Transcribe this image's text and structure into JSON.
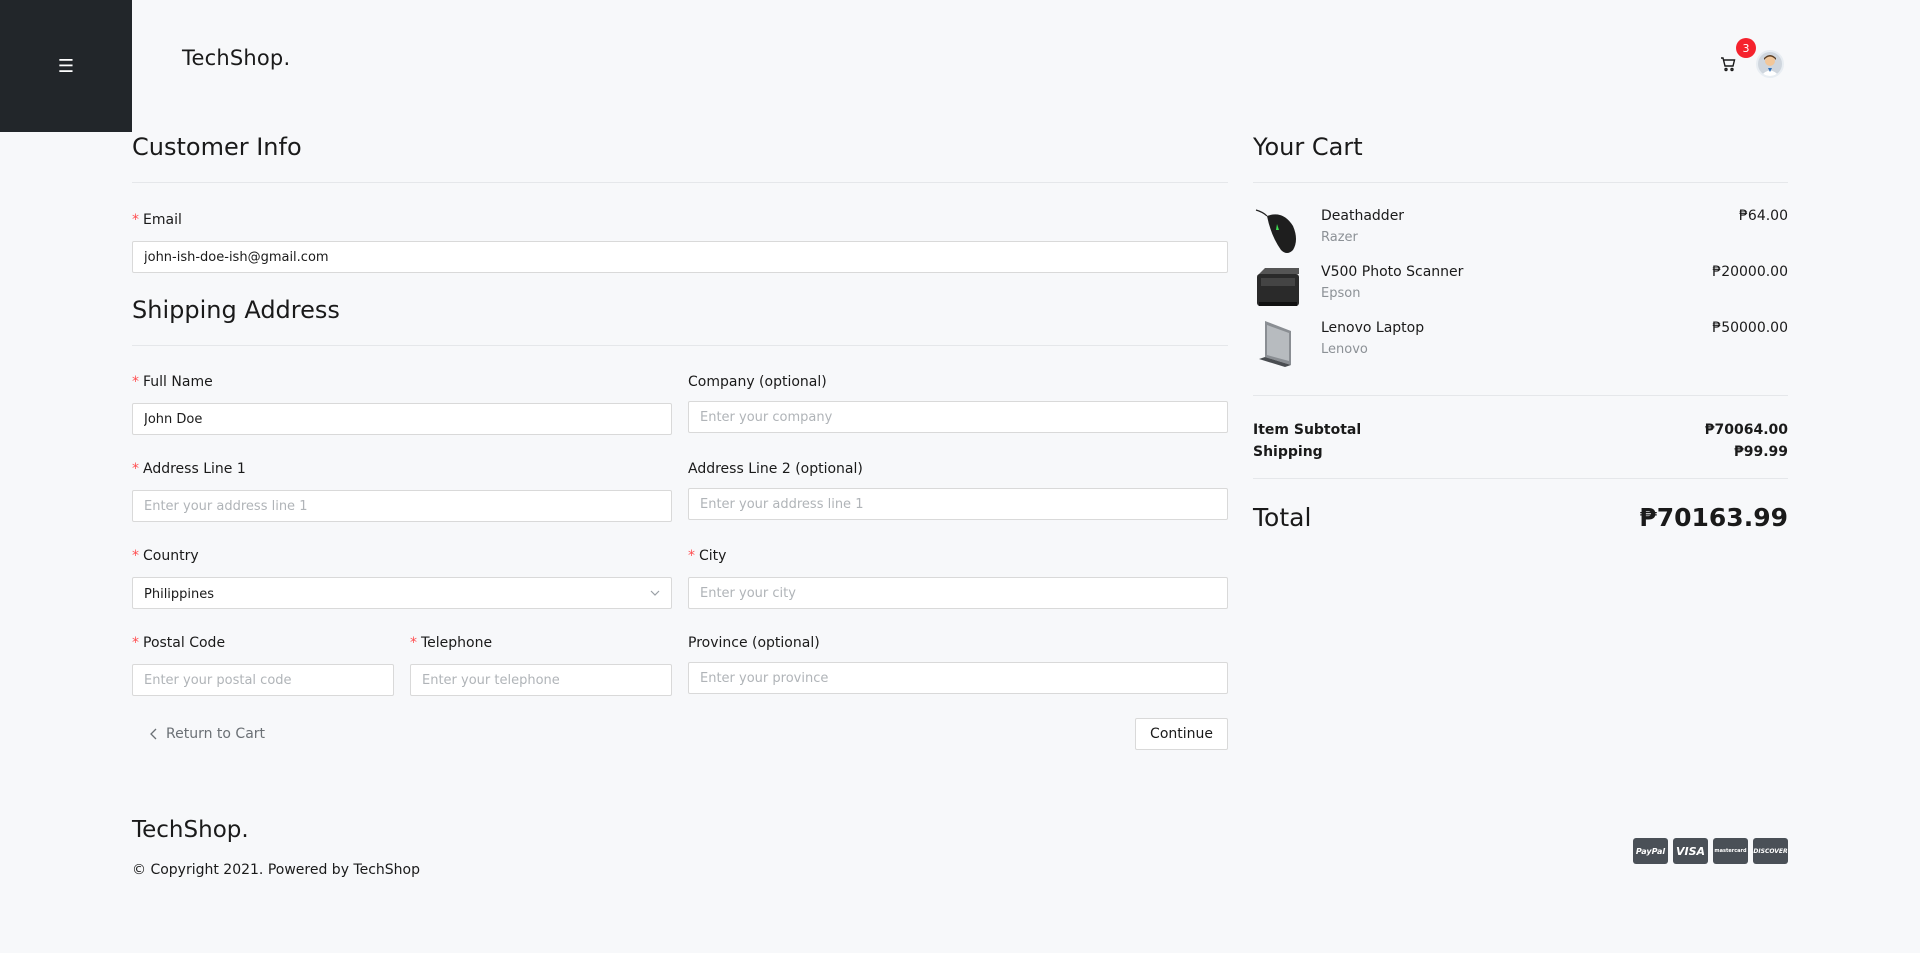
{
  "header": {
    "menu_icon": "☰",
    "brand": "TechShop.",
    "cart_count": "3"
  },
  "customer_info": {
    "title": "Customer Info",
    "email_label": "Email",
    "email_value": "john-ish-doe-ish@gmail.com"
  },
  "shipping": {
    "title": "Shipping Address",
    "full_name_label": "Full Name",
    "full_name_value": "John Doe",
    "company_label": "Company (optional)",
    "company_placeholder": "Enter your company",
    "address1_label": "Address Line 1",
    "address1_placeholder": "Enter your address line 1",
    "address2_label": "Address Line 2 (optional)",
    "address2_placeholder": "Enter your address line 1",
    "country_label": "Country",
    "country_value": "Philippines",
    "city_label": "City",
    "city_placeholder": "Enter your city",
    "postal_label": "Postal Code",
    "postal_placeholder": "Enter your postal code",
    "telephone_label": "Telephone",
    "telephone_placeholder": "Enter your telephone",
    "province_label": "Province (optional)",
    "province_placeholder": "Enter your province",
    "required_mark": "*"
  },
  "actions": {
    "return_label": "Return to Cart",
    "continue_label": "Continue"
  },
  "cart": {
    "title": "Your Cart",
    "items": [
      {
        "name": "Deathadder",
        "brand": "Razer",
        "price": "₱64.00"
      },
      {
        "name": "V500 Photo Scanner",
        "brand": "Epson",
        "price": "₱20000.00"
      },
      {
        "name": "Lenovo Laptop",
        "brand": "Lenovo",
        "price": "₱50000.00"
      }
    ],
    "subtotal_label": "Item Subtotal",
    "subtotal_value": "₱70064.00",
    "shipping_label": "Shipping",
    "shipping_value": "₱99.99",
    "total_label": "Total",
    "total_value": "₱70163.99"
  },
  "footer": {
    "brand": "TechShop.",
    "copyright": "© Copyright 2021. Powered by TechShop",
    "payments": [
      "PayPal",
      "VISA",
      "mastercard",
      "DISCOVER"
    ]
  }
}
